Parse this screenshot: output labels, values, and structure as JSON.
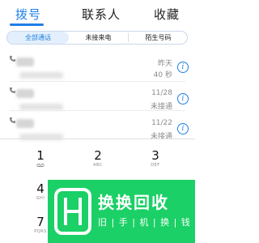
{
  "tabs": [
    {
      "label": "拨号",
      "active": true
    },
    {
      "label": "联系人",
      "active": false
    },
    {
      "label": "收藏",
      "active": false
    }
  ],
  "filters": [
    {
      "label": "全部通话",
      "active": true
    },
    {
      "label": "未接来电",
      "active": false
    },
    {
      "label": "陌生号码",
      "active": false
    }
  ],
  "calls": [
    {
      "time": "昨天",
      "status": "40 秒"
    },
    {
      "time": "11/28",
      "status": "未接通"
    },
    {
      "time": "11/22",
      "status": "未接通"
    }
  ],
  "info_glyph": "i",
  "dialpad": [
    {
      "digit": "1",
      "letters": ""
    },
    {
      "digit": "2",
      "letters": "ABC"
    },
    {
      "digit": "3",
      "letters": "DEF"
    },
    {
      "digit": "4",
      "letters": "GHI"
    },
    {
      "digit": "7",
      "letters": "PQRS"
    }
  ],
  "watermark": {
    "title": "换换回收",
    "subtitle": "旧 | 手 | 机 | 换 | 钱"
  },
  "colors": {
    "accent": "#1e7fe5",
    "watermark_green": "#1bd066"
  }
}
